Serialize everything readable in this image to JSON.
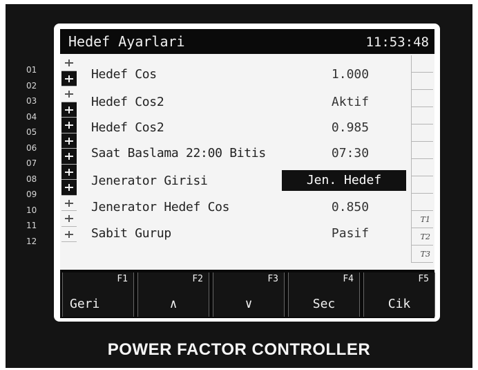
{
  "screen": {
    "title": "Hedef Ayarlari",
    "clock": "11:53:48"
  },
  "channels": [
    "01",
    "02",
    "03",
    "04",
    "05",
    "06",
    "07",
    "08",
    "09",
    "10",
    "11",
    "12"
  ],
  "steps_on": [
    false,
    true,
    false,
    true,
    true,
    true,
    true,
    true,
    true,
    false,
    false,
    false
  ],
  "settings": [
    {
      "label": "Hedef Cos",
      "value": "1.000"
    },
    {
      "label": "Hedef Cos2",
      "value": "Aktif"
    },
    {
      "label": "Hedef Cos2",
      "value": "0.985"
    },
    {
      "label": "Saat Baslama 22:00 Bitis",
      "value": "07:30"
    },
    {
      "label": "Jenerator Girisi",
      "value": "Jen. Hedef"
    },
    {
      "label": "Jenerator Hedef Cos",
      "value": "0.850"
    },
    {
      "label": "Sabit Gurup",
      "value": "Pasif"
    }
  ],
  "selected_index": 4,
  "indicators": [
    "T1",
    "T2",
    "T3"
  ],
  "function_keys": [
    {
      "key": "F1",
      "label": "Geri"
    },
    {
      "key": "F2",
      "label": "∧",
      "icon": "up-arrow-icon"
    },
    {
      "key": "F3",
      "label": "∨",
      "icon": "down-arrow-icon"
    },
    {
      "key": "F4",
      "label": "Sec"
    },
    {
      "key": "F5",
      "label": "Cik"
    }
  ],
  "brand": "POWER FACTOR CONTROLLER"
}
